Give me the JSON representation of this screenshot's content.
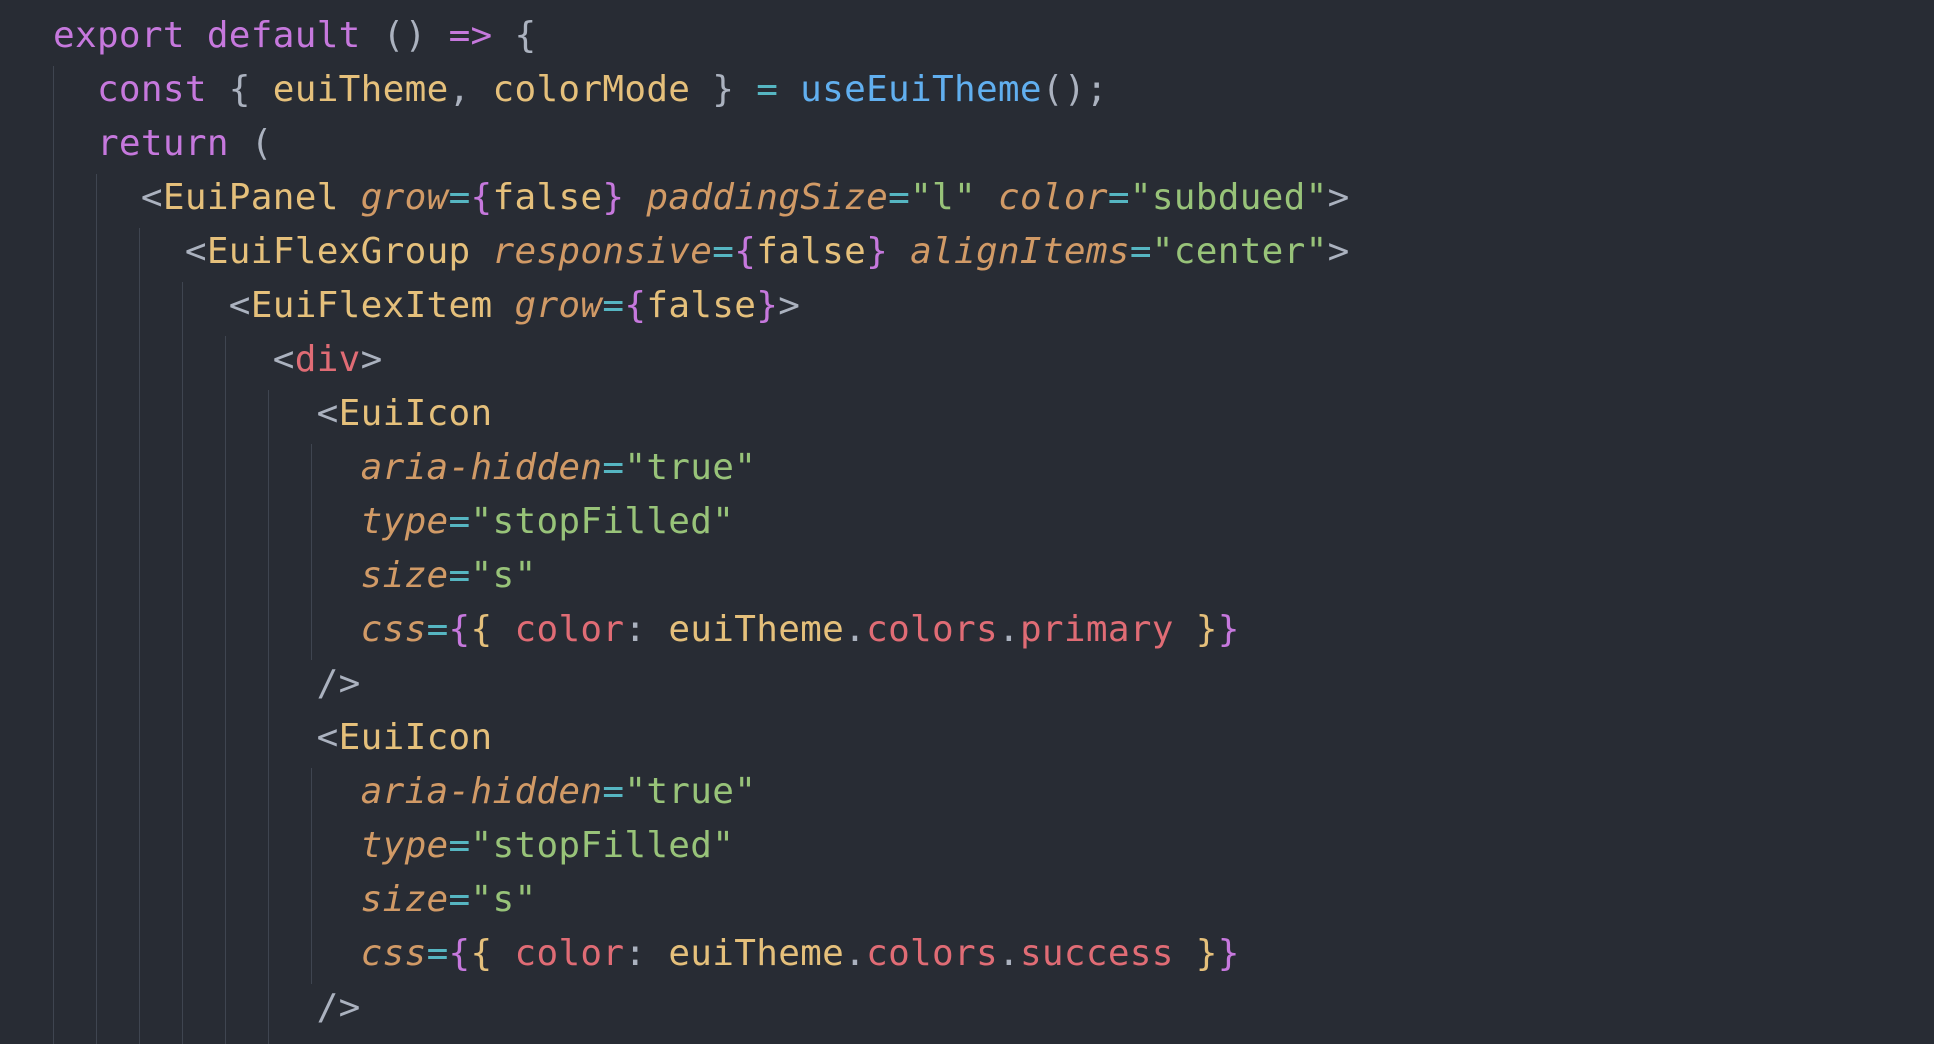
{
  "editor": {
    "theme_colors": {
      "background": "#282c34",
      "keyword": "#c678dd",
      "plain": "#abb2bf",
      "variable": "#e5c07b",
      "function": "#61afef",
      "tag": "#e06c75",
      "attribute": "#d19a66",
      "operator": "#56b6c2",
      "string": "#98c379",
      "indent_guide": "#3f4550"
    },
    "lines": [
      [
        [
          "kw",
          "export"
        ],
        [
          "pl",
          " "
        ],
        [
          "kw",
          "default"
        ],
        [
          "pl",
          " () "
        ],
        [
          "kw",
          "=>"
        ],
        [
          "pl",
          " {"
        ]
      ],
      [
        [
          "pl",
          "  "
        ],
        [
          "kw",
          "const"
        ],
        [
          "pl",
          " { "
        ],
        [
          "var",
          "euiTheme"
        ],
        [
          "pl",
          ", "
        ],
        [
          "var",
          "colorMode"
        ],
        [
          "pl",
          " } "
        ],
        [
          "op",
          "="
        ],
        [
          "pl",
          " "
        ],
        [
          "fn",
          "useEuiTheme"
        ],
        [
          "pl",
          "();"
        ]
      ],
      [
        [
          "pl",
          "  "
        ],
        [
          "kw",
          "return"
        ],
        [
          "pl",
          " ("
        ]
      ],
      [
        [
          "pl",
          "    <"
        ],
        [
          "var",
          "EuiPanel"
        ],
        [
          "pl",
          " "
        ],
        [
          "attr",
          "grow"
        ],
        [
          "op",
          "="
        ],
        [
          "br1",
          "{"
        ],
        [
          "var",
          "false"
        ],
        [
          "br1",
          "}"
        ],
        [
          "pl",
          " "
        ],
        [
          "attr",
          "paddingSize"
        ],
        [
          "op",
          "="
        ],
        [
          "str",
          "\"l\""
        ],
        [
          "pl",
          " "
        ],
        [
          "attr",
          "color"
        ],
        [
          "op",
          "="
        ],
        [
          "str",
          "\"subdued\""
        ],
        [
          "pl",
          ">"
        ]
      ],
      [
        [
          "pl",
          "      <"
        ],
        [
          "var",
          "EuiFlexGroup"
        ],
        [
          "pl",
          " "
        ],
        [
          "attr",
          "responsive"
        ],
        [
          "op",
          "="
        ],
        [
          "br1",
          "{"
        ],
        [
          "var",
          "false"
        ],
        [
          "br1",
          "}"
        ],
        [
          "pl",
          " "
        ],
        [
          "attr",
          "alignItems"
        ],
        [
          "op",
          "="
        ],
        [
          "str",
          "\"center\""
        ],
        [
          "pl",
          ">"
        ]
      ],
      [
        [
          "pl",
          "        <"
        ],
        [
          "var",
          "EuiFlexItem"
        ],
        [
          "pl",
          " "
        ],
        [
          "attr",
          "grow"
        ],
        [
          "op",
          "="
        ],
        [
          "br1",
          "{"
        ],
        [
          "var",
          "false"
        ],
        [
          "br1",
          "}"
        ],
        [
          "pl",
          ">"
        ]
      ],
      [
        [
          "pl",
          "          <"
        ],
        [
          "tag",
          "div"
        ],
        [
          "pl",
          ">"
        ]
      ],
      [
        [
          "pl",
          "            <"
        ],
        [
          "var",
          "EuiIcon"
        ]
      ],
      [
        [
          "pl",
          "              "
        ],
        [
          "attr",
          "aria-hidden"
        ],
        [
          "op",
          "="
        ],
        [
          "str",
          "\"true\""
        ]
      ],
      [
        [
          "pl",
          "              "
        ],
        [
          "attr",
          "type"
        ],
        [
          "op",
          "="
        ],
        [
          "str",
          "\"stopFilled\""
        ]
      ],
      [
        [
          "pl",
          "              "
        ],
        [
          "attr",
          "size"
        ],
        [
          "op",
          "="
        ],
        [
          "str",
          "\"s\""
        ]
      ],
      [
        [
          "pl",
          "              "
        ],
        [
          "attr",
          "css"
        ],
        [
          "op",
          "="
        ],
        [
          "br1",
          "{"
        ],
        [
          "br2",
          "{"
        ],
        [
          "pl",
          " "
        ],
        [
          "prop",
          "color"
        ],
        [
          "pl",
          ": "
        ],
        [
          "var",
          "euiTheme"
        ],
        [
          "pl",
          "."
        ],
        [
          "prop",
          "colors"
        ],
        [
          "pl",
          "."
        ],
        [
          "prop",
          "primary"
        ],
        [
          "pl",
          " "
        ],
        [
          "br2",
          "}"
        ],
        [
          "br1",
          "}"
        ]
      ],
      [
        [
          "pl",
          "            />"
        ]
      ],
      [
        [
          "pl",
          "            <"
        ],
        [
          "var",
          "EuiIcon"
        ]
      ],
      [
        [
          "pl",
          "              "
        ],
        [
          "attr",
          "aria-hidden"
        ],
        [
          "op",
          "="
        ],
        [
          "str",
          "\"true\""
        ]
      ],
      [
        [
          "pl",
          "              "
        ],
        [
          "attr",
          "type"
        ],
        [
          "op",
          "="
        ],
        [
          "str",
          "\"stopFilled\""
        ]
      ],
      [
        [
          "pl",
          "              "
        ],
        [
          "attr",
          "size"
        ],
        [
          "op",
          "="
        ],
        [
          "str",
          "\"s\""
        ]
      ],
      [
        [
          "pl",
          "              "
        ],
        [
          "attr",
          "css"
        ],
        [
          "op",
          "="
        ],
        [
          "br1",
          "{"
        ],
        [
          "br2",
          "{"
        ],
        [
          "pl",
          " "
        ],
        [
          "prop",
          "color"
        ],
        [
          "pl",
          ": "
        ],
        [
          "var",
          "euiTheme"
        ],
        [
          "pl",
          "."
        ],
        [
          "prop",
          "colors"
        ],
        [
          "pl",
          "."
        ],
        [
          "prop",
          "success"
        ],
        [
          "pl",
          " "
        ],
        [
          "br2",
          "}"
        ],
        [
          "br1",
          "}"
        ]
      ],
      [
        [
          "pl",
          "            />"
        ]
      ]
    ]
  }
}
